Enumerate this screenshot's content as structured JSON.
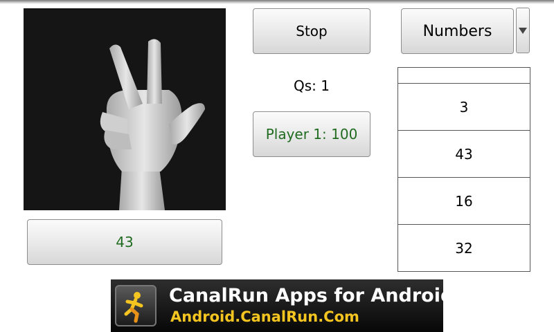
{
  "sign_image": {
    "icon": "hand-sign-three-icon"
  },
  "controls": {
    "stop_label": "Stop",
    "category_selected": "Numbers",
    "questions_label": "Qs: 1",
    "player_score_label": "Player 1: 100",
    "answer_button_label": "43"
  },
  "answers": {
    "header": "",
    "items": [
      "3",
      "43",
      "16",
      "32"
    ]
  },
  "ad": {
    "title": "CanalRun Apps for Android",
    "url": "Android.CanalRun.Com",
    "icon": "running-man-icon"
  },
  "colors": {
    "score_text": "#1f6b1f",
    "ad_url": "#f4c520"
  }
}
